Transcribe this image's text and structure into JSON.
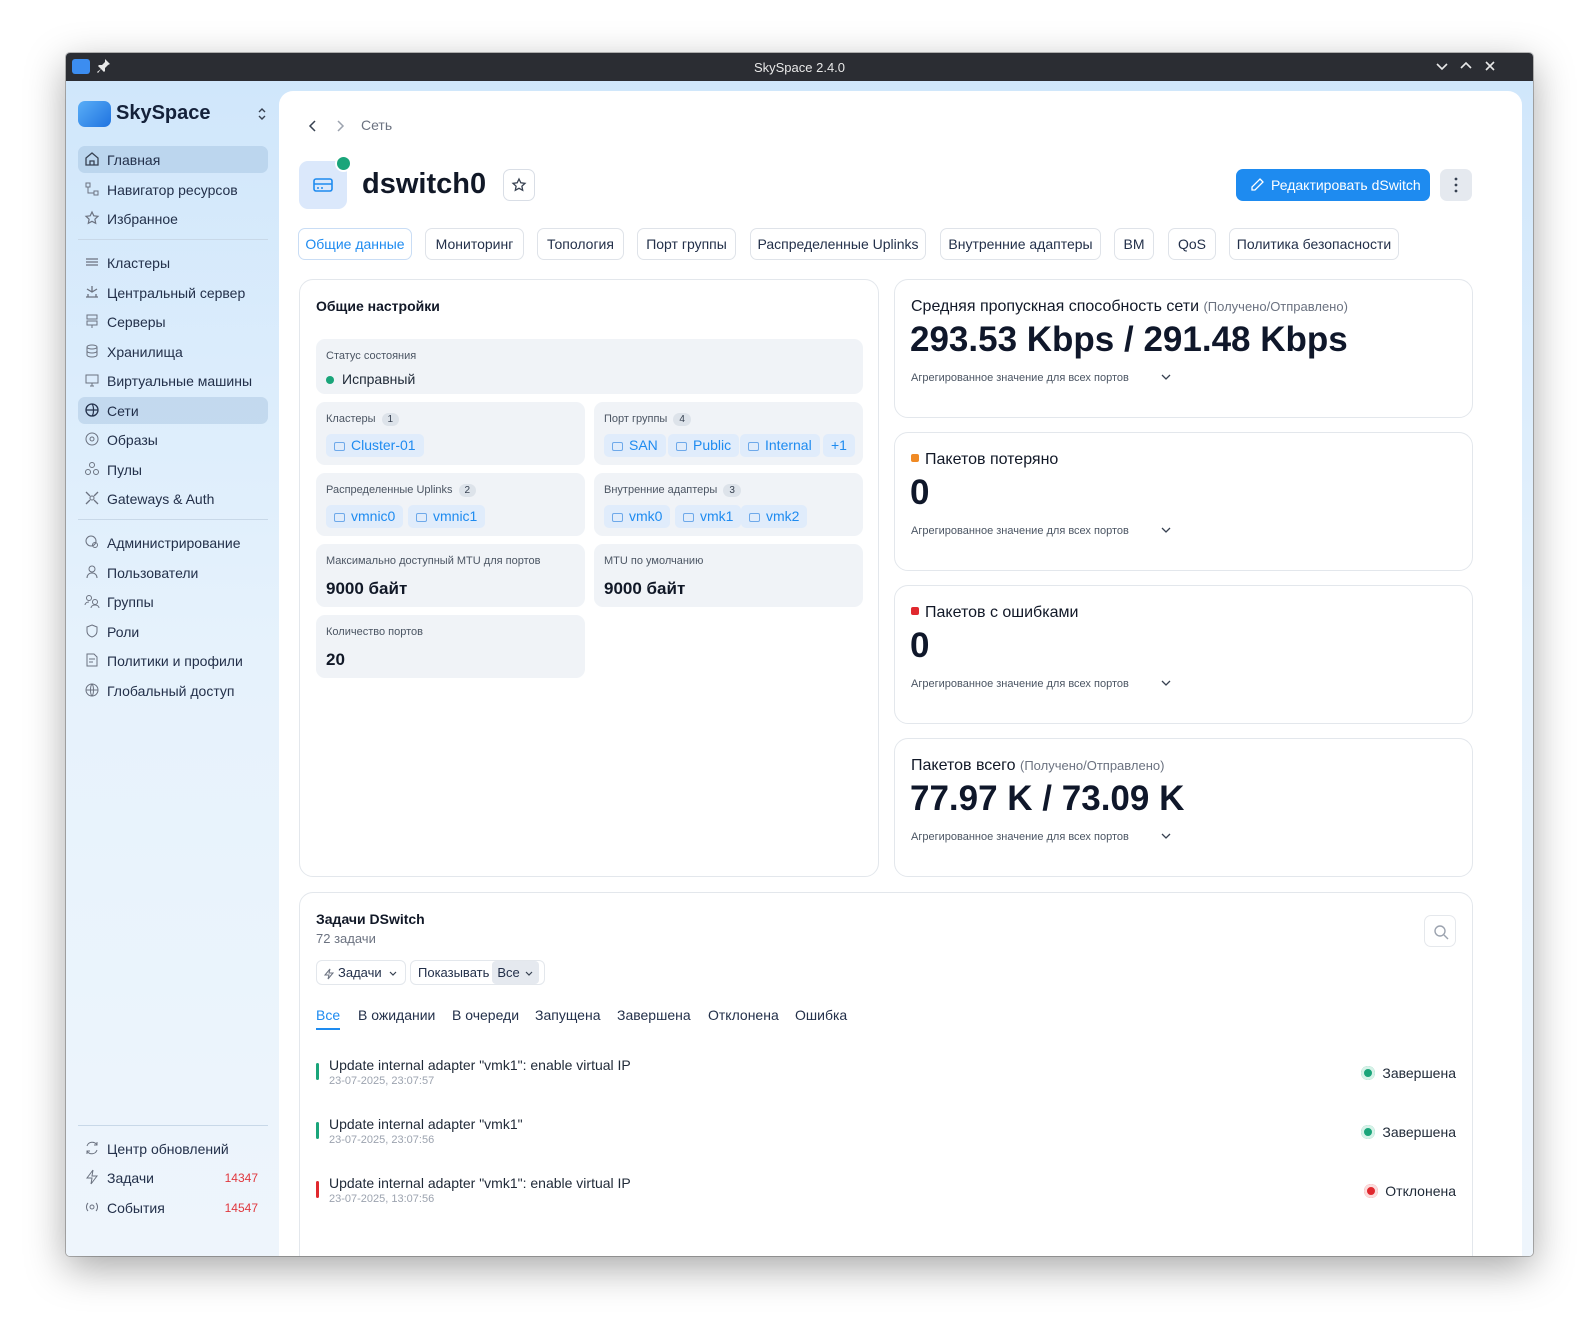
{
  "window": {
    "title": "SkySpace 2.4.0"
  },
  "brand": {
    "name": "SkySpace"
  },
  "sidebar": {
    "items": [
      {
        "label": "Главная",
        "icon": "home-icon",
        "active": true
      },
      {
        "label": "Навигатор ресурсов",
        "icon": "resource-navigator-icon"
      },
      {
        "label": "Избранное",
        "icon": "star-icon"
      },
      {
        "label": "Кластеры",
        "icon": "clusters-icon"
      },
      {
        "label": "Центральный сервер",
        "icon": "central-server-icon"
      },
      {
        "label": "Серверы",
        "icon": "servers-icon"
      },
      {
        "label": "Хранилища",
        "icon": "storage-icon"
      },
      {
        "label": "Виртуальные машины",
        "icon": "monitor-icon"
      },
      {
        "label": "Сети",
        "icon": "network-icon",
        "active": true
      },
      {
        "label": "Образы",
        "icon": "disc-icon"
      },
      {
        "label": "Пулы",
        "icon": "pools-icon"
      },
      {
        "label": "Gateways & Auth",
        "icon": "gateway-icon"
      },
      {
        "label": "Администрирование",
        "icon": "admin-icon"
      },
      {
        "label": "Пользователи",
        "icon": "user-icon"
      },
      {
        "label": "Группы",
        "icon": "groups-icon"
      },
      {
        "label": "Роли",
        "icon": "shield-icon"
      },
      {
        "label": "Политики и профили",
        "icon": "policy-icon"
      },
      {
        "label": "Глобальный доступ",
        "icon": "globe-icon"
      }
    ],
    "bottom": [
      {
        "label": "Центр обновлений",
        "icon": "refresh-icon"
      },
      {
        "label": "Задачи",
        "icon": "bolt-icon",
        "count": "14347"
      },
      {
        "label": "События",
        "icon": "broadcast-icon",
        "count": "14547"
      }
    ]
  },
  "breadcrumb": {
    "current": "Сеть"
  },
  "header": {
    "title": "dswitch0",
    "edit_label": "Редактировать dSwitch"
  },
  "tabs": [
    "Общие данные",
    "Мониторинг",
    "Топология",
    "Порт группы",
    "Распределенные Uplinks",
    "Внутренние адаптеры",
    "ВМ",
    "QoS",
    "Политика безопасности"
  ],
  "general": {
    "title": "Общие настройки",
    "status_label": "Статус состояния",
    "status_value": "Исправный",
    "clusters_label": "Кластеры",
    "clusters_count": "1",
    "clusters": [
      "Cluster-01"
    ],
    "port_groups_label": "Порт группы",
    "port_groups_count": "4",
    "port_groups": [
      "SAN",
      "Public",
      "Internal"
    ],
    "port_groups_more": "+1",
    "uplinks_label": "Распределенные Uplinks",
    "uplinks_count": "2",
    "uplinks": [
      "vmnic0",
      "vmnic1"
    ],
    "adapters_label": "Внутренние адаптеры",
    "adapters_count": "3",
    "adapters": [
      "vmk0",
      "vmk1",
      "vmk2"
    ],
    "max_mtu_label": "Максимально доступный MTU для портов",
    "max_mtu_value": "9000 байт",
    "default_mtu_label": "MTU по умолчанию",
    "default_mtu_value": "9000 байт",
    "ports_label": "Количество портов",
    "ports_value": "20"
  },
  "metrics": [
    {
      "title": "Средняя пропускная способность сети",
      "sub": "(Получено/Отправлено)",
      "value": "293.53 Kbps / 291.48 Kbps",
      "agg": "Агрегированное значение для всех портов"
    },
    {
      "title": "Пакетов потеряно",
      "sub": "",
      "value": "0",
      "agg": "Агрегированное значение для всех портов",
      "marker_color": "#f08a24"
    },
    {
      "title": "Пакетов с ошибками",
      "sub": "",
      "value": "0",
      "agg": "Агрегированное значение для всех портов",
      "marker_color": "#e0282e"
    },
    {
      "title": "Пакетов всего",
      "sub": "(Получено/Отправлено)",
      "value": "77.97 K / 73.09 K",
      "agg": "Агрегированное значение для всех портов"
    }
  ],
  "tasks": {
    "title": "Задачи DSwitch",
    "count": "72 задачи",
    "filter_label": "Задачи",
    "show_label": "Показывать",
    "show_value": "Все",
    "tabs": [
      "Все",
      "В ожидании",
      "В очереди",
      "Запущена",
      "Завершена",
      "Отклонена",
      "Ошибка"
    ],
    "rows": [
      {
        "name": "Update internal adapter \"vmk1\": enable virtual IP",
        "date": "23-07-2025, 23:07:57",
        "status": "Завершена",
        "color": "#1aa57a"
      },
      {
        "name": "Update internal adapter \"vmk1\"",
        "date": "23-07-2025, 23:07:56",
        "status": "Завершена",
        "color": "#1aa57a"
      },
      {
        "name": "Update internal adapter \"vmk1\": enable virtual IP",
        "date": "23-07-2025, 13:07:56",
        "status": "Отклонена",
        "color": "#e0282e"
      }
    ]
  }
}
